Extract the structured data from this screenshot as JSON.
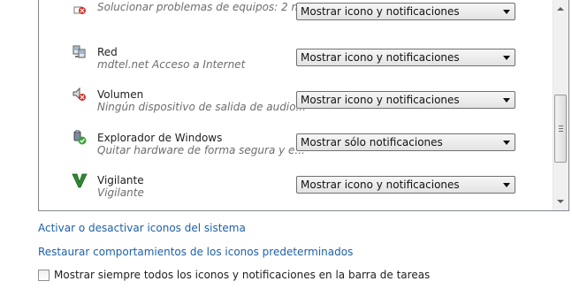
{
  "rows": [
    {
      "name": "",
      "description": "Solucionar problemas de equipos: 2 m...",
      "behavior": "Mostrar icono y notificaciones",
      "icon": "action-center-icon"
    },
    {
      "name": "Red",
      "description": "mdtel.net Acceso a Internet",
      "behavior": "Mostrar icono y notificaciones",
      "icon": "network-icon"
    },
    {
      "name": "Volumen",
      "description": "Ningún dispositivo de salida de audio...",
      "behavior": "Mostrar icono y notificaciones",
      "icon": "volume-muted-icon"
    },
    {
      "name": "Explorador de Windows",
      "description": "Quitar hardware de forma segura y e...",
      "behavior": "Mostrar sólo notificaciones",
      "icon": "safely-remove-hardware-icon"
    },
    {
      "name": "Vigilante",
      "description": "Vigilante",
      "behavior": "Mostrar icono y notificaciones",
      "icon": "vigilante-icon"
    }
  ],
  "links": {
    "system_icons": "Activar o desactivar iconos del sistema",
    "restore_defaults": "Restaurar comportamientos de los iconos predeterminados"
  },
  "always_show": {
    "label": "Mostrar siempre todos los iconos y notificaciones en la barra de tareas",
    "checked": false
  },
  "colors": {
    "link": "#1e5fa8",
    "description_text": "#6d6d6d"
  }
}
